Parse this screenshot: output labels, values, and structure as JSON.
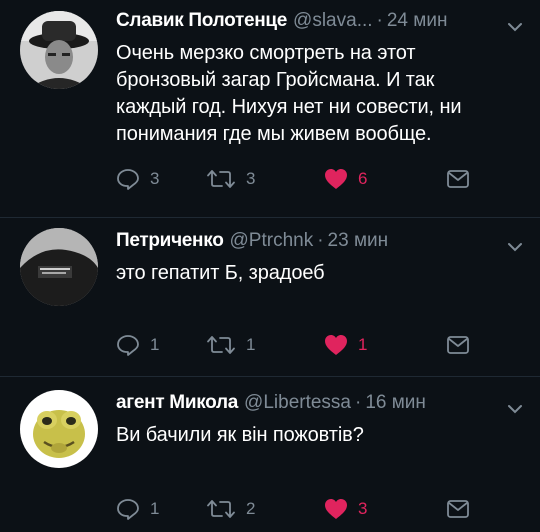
{
  "tweets": [
    {
      "name": "Славик Полотенце",
      "handle": "@slava...",
      "separator": "·",
      "time": "24 мин",
      "text": "Очень мерзко смортреть на этот бронзовый загар Гройсмана. И так каждый год. Нихуя нет ни совести, ни понимания где мы живем вообще.",
      "replies": "3",
      "retweets": "3",
      "likes": "6",
      "liked": true
    },
    {
      "name": "Петриченко",
      "handle": "@Ptrchnk",
      "separator": "·",
      "time": "23 мин",
      "text": "это гепатит Б, зрадоеб",
      "replies": "1",
      "retweets": "1",
      "likes": "1",
      "liked": true
    },
    {
      "name": "агент Микола",
      "handle": "@Libertessa",
      "separator": "·",
      "time": "16 мин",
      "text": "Ви бачили як він пожовтів?",
      "replies": "1",
      "retweets": "2",
      "likes": "3",
      "liked": true
    }
  ],
  "icons": {
    "reply": "reply-icon",
    "retweet": "retweet-icon",
    "like": "heart-icon",
    "dm": "envelope-icon",
    "menu": "chevron-down-icon"
  },
  "colors": {
    "background": "#0c1116",
    "secondary_text": "#7f8b96",
    "like": "#e0245e"
  }
}
